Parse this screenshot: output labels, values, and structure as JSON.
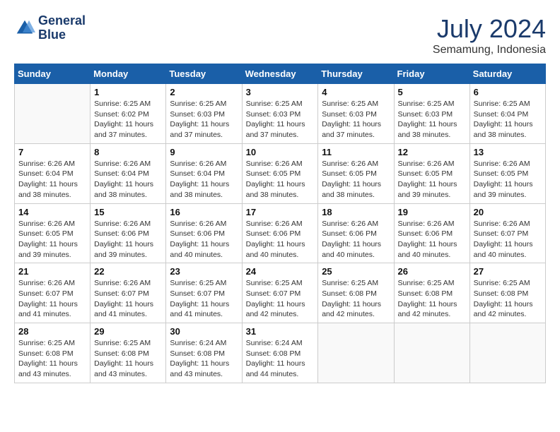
{
  "logo": {
    "line1": "General",
    "line2": "Blue"
  },
  "title": "July 2024",
  "location": "Semamung, Indonesia",
  "headers": [
    "Sunday",
    "Monday",
    "Tuesday",
    "Wednesday",
    "Thursday",
    "Friday",
    "Saturday"
  ],
  "weeks": [
    [
      {
        "day": "",
        "sunrise": "",
        "sunset": "",
        "daylight": ""
      },
      {
        "day": "1",
        "sunrise": "Sunrise: 6:25 AM",
        "sunset": "Sunset: 6:02 PM",
        "daylight": "Daylight: 11 hours and 37 minutes."
      },
      {
        "day": "2",
        "sunrise": "Sunrise: 6:25 AM",
        "sunset": "Sunset: 6:03 PM",
        "daylight": "Daylight: 11 hours and 37 minutes."
      },
      {
        "day": "3",
        "sunrise": "Sunrise: 6:25 AM",
        "sunset": "Sunset: 6:03 PM",
        "daylight": "Daylight: 11 hours and 37 minutes."
      },
      {
        "day": "4",
        "sunrise": "Sunrise: 6:25 AM",
        "sunset": "Sunset: 6:03 PM",
        "daylight": "Daylight: 11 hours and 37 minutes."
      },
      {
        "day": "5",
        "sunrise": "Sunrise: 6:25 AM",
        "sunset": "Sunset: 6:03 PM",
        "daylight": "Daylight: 11 hours and 38 minutes."
      },
      {
        "day": "6",
        "sunrise": "Sunrise: 6:25 AM",
        "sunset": "Sunset: 6:04 PM",
        "daylight": "Daylight: 11 hours and 38 minutes."
      }
    ],
    [
      {
        "day": "7",
        "sunrise": "Sunrise: 6:26 AM",
        "sunset": "Sunset: 6:04 PM",
        "daylight": "Daylight: 11 hours and 38 minutes."
      },
      {
        "day": "8",
        "sunrise": "Sunrise: 6:26 AM",
        "sunset": "Sunset: 6:04 PM",
        "daylight": "Daylight: 11 hours and 38 minutes."
      },
      {
        "day": "9",
        "sunrise": "Sunrise: 6:26 AM",
        "sunset": "Sunset: 6:04 PM",
        "daylight": "Daylight: 11 hours and 38 minutes."
      },
      {
        "day": "10",
        "sunrise": "Sunrise: 6:26 AM",
        "sunset": "Sunset: 6:05 PM",
        "daylight": "Daylight: 11 hours and 38 minutes."
      },
      {
        "day": "11",
        "sunrise": "Sunrise: 6:26 AM",
        "sunset": "Sunset: 6:05 PM",
        "daylight": "Daylight: 11 hours and 38 minutes."
      },
      {
        "day": "12",
        "sunrise": "Sunrise: 6:26 AM",
        "sunset": "Sunset: 6:05 PM",
        "daylight": "Daylight: 11 hours and 39 minutes."
      },
      {
        "day": "13",
        "sunrise": "Sunrise: 6:26 AM",
        "sunset": "Sunset: 6:05 PM",
        "daylight": "Daylight: 11 hours and 39 minutes."
      }
    ],
    [
      {
        "day": "14",
        "sunrise": "Sunrise: 6:26 AM",
        "sunset": "Sunset: 6:05 PM",
        "daylight": "Daylight: 11 hours and 39 minutes."
      },
      {
        "day": "15",
        "sunrise": "Sunrise: 6:26 AM",
        "sunset": "Sunset: 6:06 PM",
        "daylight": "Daylight: 11 hours and 39 minutes."
      },
      {
        "day": "16",
        "sunrise": "Sunrise: 6:26 AM",
        "sunset": "Sunset: 6:06 PM",
        "daylight": "Daylight: 11 hours and 40 minutes."
      },
      {
        "day": "17",
        "sunrise": "Sunrise: 6:26 AM",
        "sunset": "Sunset: 6:06 PM",
        "daylight": "Daylight: 11 hours and 40 minutes."
      },
      {
        "day": "18",
        "sunrise": "Sunrise: 6:26 AM",
        "sunset": "Sunset: 6:06 PM",
        "daylight": "Daylight: 11 hours and 40 minutes."
      },
      {
        "day": "19",
        "sunrise": "Sunrise: 6:26 AM",
        "sunset": "Sunset: 6:06 PM",
        "daylight": "Daylight: 11 hours and 40 minutes."
      },
      {
        "day": "20",
        "sunrise": "Sunrise: 6:26 AM",
        "sunset": "Sunset: 6:07 PM",
        "daylight": "Daylight: 11 hours and 40 minutes."
      }
    ],
    [
      {
        "day": "21",
        "sunrise": "Sunrise: 6:26 AM",
        "sunset": "Sunset: 6:07 PM",
        "daylight": "Daylight: 11 hours and 41 minutes."
      },
      {
        "day": "22",
        "sunrise": "Sunrise: 6:26 AM",
        "sunset": "Sunset: 6:07 PM",
        "daylight": "Daylight: 11 hours and 41 minutes."
      },
      {
        "day": "23",
        "sunrise": "Sunrise: 6:25 AM",
        "sunset": "Sunset: 6:07 PM",
        "daylight": "Daylight: 11 hours and 41 minutes."
      },
      {
        "day": "24",
        "sunrise": "Sunrise: 6:25 AM",
        "sunset": "Sunset: 6:07 PM",
        "daylight": "Daylight: 11 hours and 42 minutes."
      },
      {
        "day": "25",
        "sunrise": "Sunrise: 6:25 AM",
        "sunset": "Sunset: 6:08 PM",
        "daylight": "Daylight: 11 hours and 42 minutes."
      },
      {
        "day": "26",
        "sunrise": "Sunrise: 6:25 AM",
        "sunset": "Sunset: 6:08 PM",
        "daylight": "Daylight: 11 hours and 42 minutes."
      },
      {
        "day": "27",
        "sunrise": "Sunrise: 6:25 AM",
        "sunset": "Sunset: 6:08 PM",
        "daylight": "Daylight: 11 hours and 42 minutes."
      }
    ],
    [
      {
        "day": "28",
        "sunrise": "Sunrise: 6:25 AM",
        "sunset": "Sunset: 6:08 PM",
        "daylight": "Daylight: 11 hours and 43 minutes."
      },
      {
        "day": "29",
        "sunrise": "Sunrise: 6:25 AM",
        "sunset": "Sunset: 6:08 PM",
        "daylight": "Daylight: 11 hours and 43 minutes."
      },
      {
        "day": "30",
        "sunrise": "Sunrise: 6:24 AM",
        "sunset": "Sunset: 6:08 PM",
        "daylight": "Daylight: 11 hours and 43 minutes."
      },
      {
        "day": "31",
        "sunrise": "Sunrise: 6:24 AM",
        "sunset": "Sunset: 6:08 PM",
        "daylight": "Daylight: 11 hours and 44 minutes."
      },
      {
        "day": "",
        "sunrise": "",
        "sunset": "",
        "daylight": ""
      },
      {
        "day": "",
        "sunrise": "",
        "sunset": "",
        "daylight": ""
      },
      {
        "day": "",
        "sunrise": "",
        "sunset": "",
        "daylight": ""
      }
    ]
  ]
}
